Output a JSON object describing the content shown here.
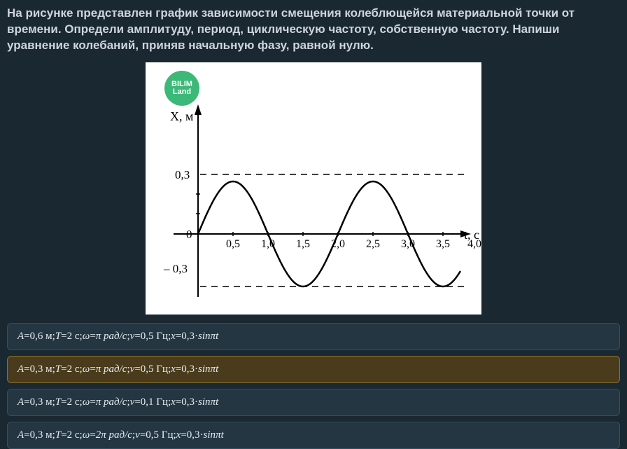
{
  "question": "На рисунке представлен график зависимости смещения колеблющейся материальной точки от времени. Определи амплитуду, период, циклическую частоту, собственную частоту. Напиши уравнение колебаний, приняв начальную фазу, равной нулю.",
  "chart_data": {
    "type": "line",
    "title": "",
    "xlabel": "t, с",
    "ylabel": "X, м",
    "xlim": [
      0,
      4
    ],
    "ylim": [
      -0.4,
      0.4
    ],
    "x_ticks": [
      "0,5",
      "1,0",
      "1,5",
      "2,0",
      "2,5",
      "3,0",
      "3,5",
      "4,0"
    ],
    "y_ticks": [
      "0,3",
      "0",
      "– 0,3"
    ],
    "reference_lines_y": [
      0.3,
      -0.3
    ],
    "series": [
      {
        "name": "displacement",
        "function": "0.3*sin(pi*t)",
        "sampled_points": {
          "t": [
            0,
            0.25,
            0.5,
            0.75,
            1.0,
            1.25,
            1.5,
            1.75,
            2.0,
            2.25,
            2.5,
            2.75,
            3.0,
            3.25,
            3.5,
            3.75
          ],
          "x": [
            0,
            0.212,
            0.3,
            0.212,
            0,
            -0.212,
            -0.3,
            -0.212,
            0,
            0.212,
            0.3,
            0.212,
            0,
            -0.212,
            -0.3,
            -0.212
          ]
        }
      }
    ],
    "logo": {
      "line1": "BILIM",
      "line2": "Land"
    }
  },
  "options": [
    {
      "A": "0,6 м",
      "T": "2 с",
      "omega_str": "π рад/с",
      "nu": "0,5 Гц",
      "eq_coeff": "0,3",
      "eq_arg": "πt",
      "selected": false
    },
    {
      "A": "0,3 м",
      "T": "2 с",
      "omega_str": "π рад/с",
      "nu": "0,5 Гц",
      "eq_coeff": "0,3",
      "eq_arg": "πt",
      "selected": true
    },
    {
      "A": "0,3 м",
      "T": "2 с",
      "omega_str": "π рад/с",
      "nu": "0,1 Гц",
      "eq_coeff": "0,3",
      "eq_arg": "πt",
      "selected": false
    },
    {
      "A": "0,3 м",
      "T": "2 с",
      "omega_str": "2π рад/с",
      "nu": "0,5 Гц",
      "eq_coeff": "0,3",
      "eq_arg": "πt",
      "selected": false
    }
  ],
  "labels": {
    "A": "A",
    "T": "T",
    "omega": "ω",
    "nu": "ν",
    "x": "x",
    "sin": "sin",
    "eq": " = ",
    "sep": "; ",
    "dot": " · "
  }
}
